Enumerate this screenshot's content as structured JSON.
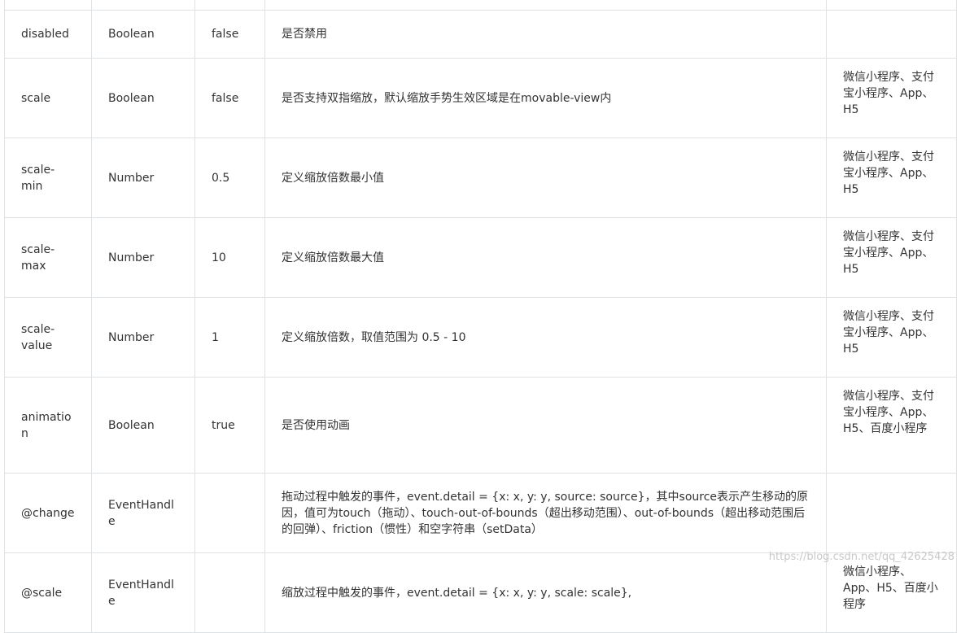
{
  "rows": [
    {
      "name": "",
      "type": "",
      "default": "",
      "desc": "",
      "platform": ""
    },
    {
      "name": "disabled",
      "type": "Boolean",
      "default": "false",
      "desc": "是否禁用",
      "platform": ""
    },
    {
      "name": "scale",
      "type": "Boolean",
      "default": "false",
      "desc": "是否支持双指缩放，默认缩放手势生效区域是在movable-view内",
      "platform": "微信小程序、支付宝小程序、App、H5"
    },
    {
      "name": "scale-min",
      "type": "Number",
      "default": "0.5",
      "desc": "定义缩放倍数最小值",
      "platform": "微信小程序、支付宝小程序、App、H5"
    },
    {
      "name": "scale-max",
      "type": "Number",
      "default": "10",
      "desc": "定义缩放倍数最大值",
      "platform": "微信小程序、支付宝小程序、App、H5"
    },
    {
      "name": "scale-value",
      "type": "Number",
      "default": "1",
      "desc": "定义缩放倍数，取值范围为 0.5 - 10",
      "platform": "微信小程序、支付宝小程序、App、H5"
    },
    {
      "name": "animation",
      "type": "Boolean",
      "default": "true",
      "desc": "是否使用动画",
      "platform": "微信小程序、支付宝小程序、App、H5、百度小程序"
    },
    {
      "name": "@change",
      "type": "EventHandle",
      "default": "",
      "desc": "拖动过程中触发的事件，event.detail = {x: x, y: y, source: source}，其中source表示产生移动的原因，值可为touch（拖动）、touch-out-of-bounds（超出移动范围）、out-of-bounds（超出移动范围后的回弹）、friction（惯性）和空字符串（setData）",
      "platform": ""
    },
    {
      "name": "@scale",
      "type": "EventHandle",
      "default": "",
      "desc": "缩放过程中触发的事件，event.detail = {x: x, y: y, scale: scale},",
      "platform": "微信小程序、App、H5、百度小程序"
    }
  ],
  "watermark": "https://blog.csdn.net/qq_42625428"
}
